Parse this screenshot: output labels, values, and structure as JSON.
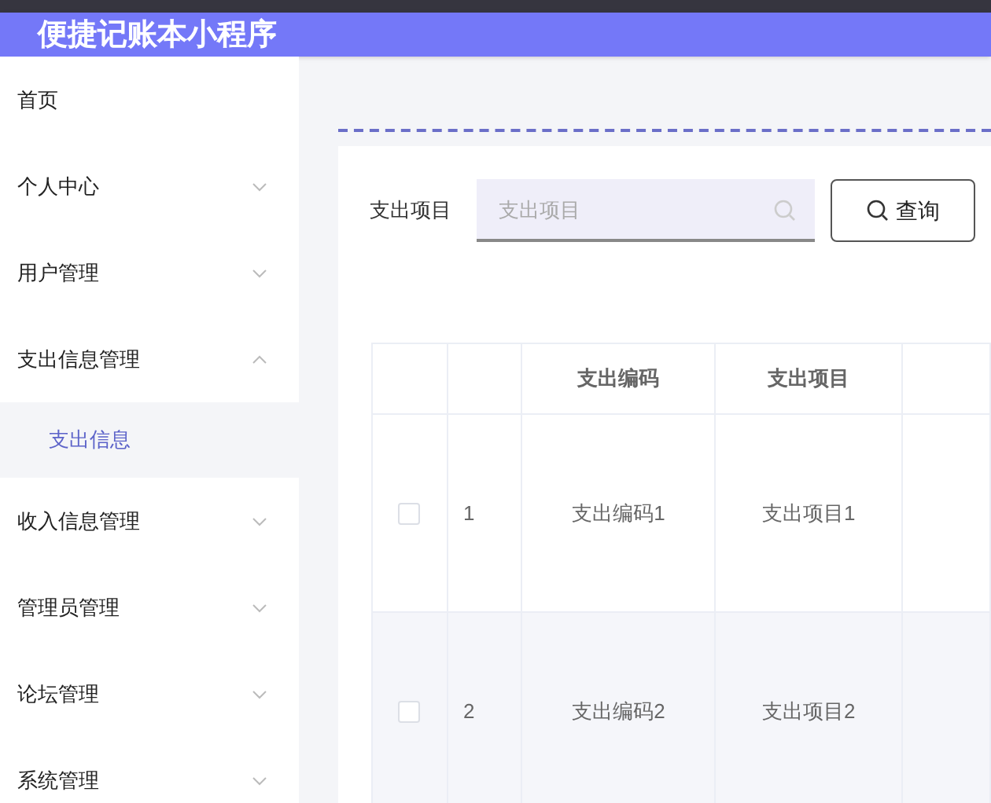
{
  "header": {
    "title": "便捷记账本小程序"
  },
  "sidebar": {
    "items": [
      {
        "label": "首页",
        "kind": "link"
      },
      {
        "label": "个人中心",
        "kind": "group",
        "expanded": false
      },
      {
        "label": "用户管理",
        "kind": "group",
        "expanded": false
      },
      {
        "label": "支出信息管理",
        "kind": "group",
        "expanded": true,
        "children": [
          {
            "label": "支出信息",
            "selected": true
          }
        ]
      },
      {
        "label": "收入信息管理",
        "kind": "group",
        "expanded": false
      },
      {
        "label": "管理员管理",
        "kind": "group",
        "expanded": false
      },
      {
        "label": "论坛管理",
        "kind": "group",
        "expanded": false
      },
      {
        "label": "系统管理",
        "kind": "group",
        "expanded": false
      }
    ]
  },
  "search": {
    "label": "支出项目",
    "placeholder": "支出项目",
    "button": "查询"
  },
  "table": {
    "columns": [
      "",
      "",
      "支出编码",
      "支出项目",
      ""
    ],
    "rows": [
      {
        "checked": false,
        "index": "1",
        "code": "支出编码1",
        "item": "支出项目1"
      },
      {
        "checked": false,
        "index": "2",
        "code": "支出编码2",
        "item": "支出项目2"
      }
    ]
  }
}
